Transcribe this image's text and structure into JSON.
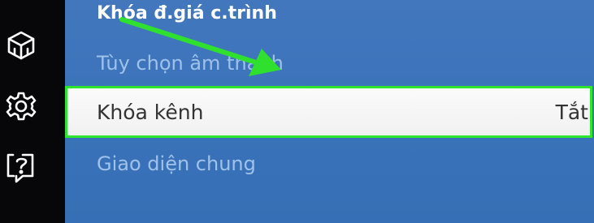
{
  "sidebar": {
    "icons": [
      "smart-hub-icon",
      "settings-gear-icon",
      "help-support-icon"
    ]
  },
  "menu": {
    "item_program_lock": "Khóa đ.giá c.trình",
    "item_audio_options": "Tùy chọn âm thanh",
    "item_channel_lock": {
      "label": "Khóa kênh",
      "value": "Tắt"
    },
    "item_general": "Giao diện chung"
  },
  "colors": {
    "background": "#3b73ba",
    "sidebar": "#070709",
    "highlight_border": "#2ee62e",
    "annotation_arrow": "#2fe02f"
  }
}
